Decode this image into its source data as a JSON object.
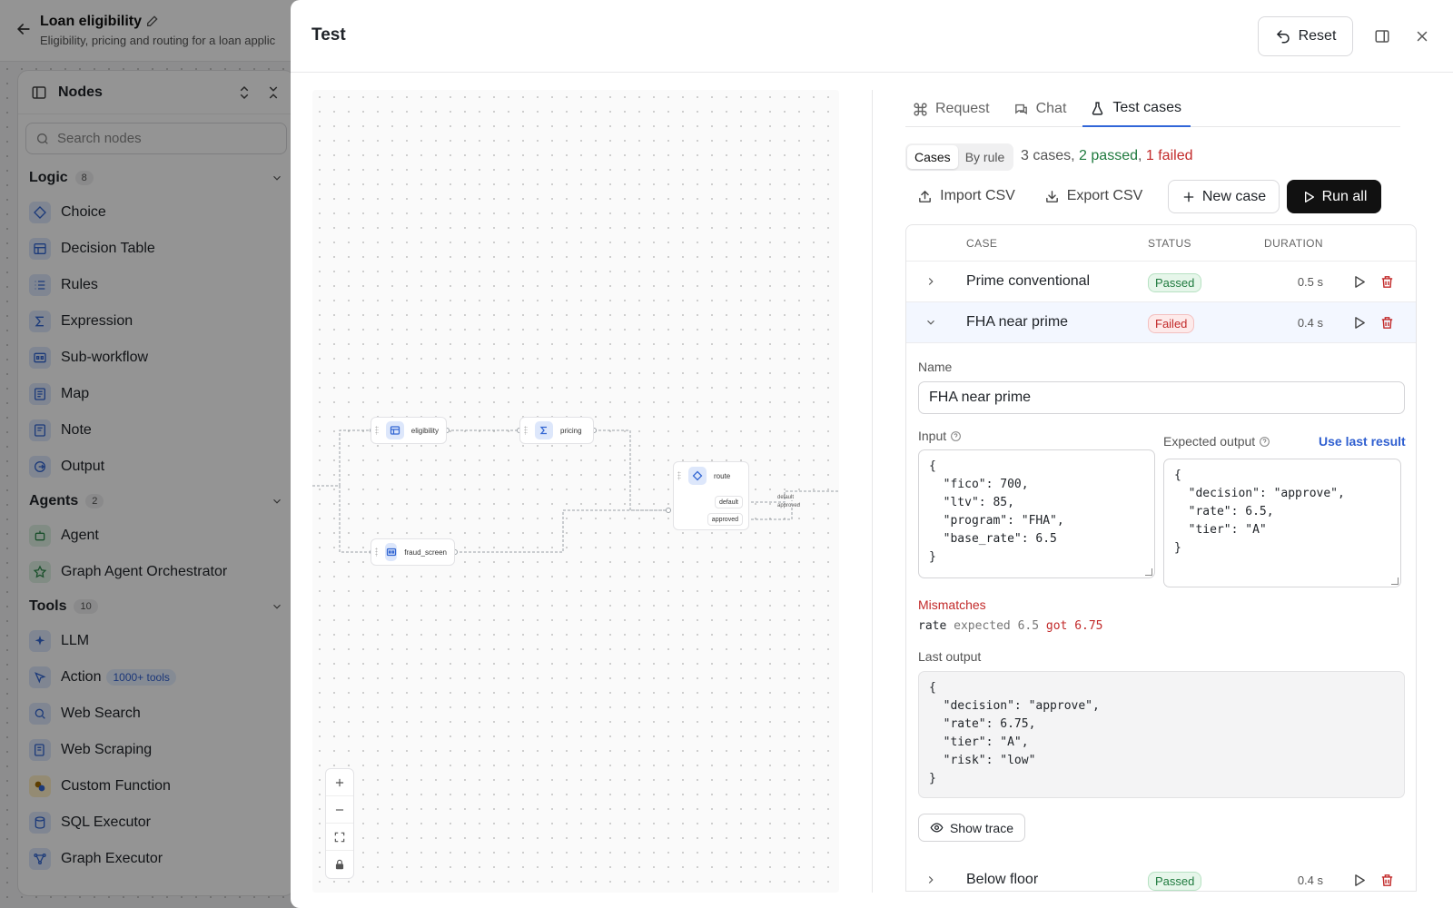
{
  "app": {
    "title": "Loan eligibility",
    "subtitle": "Eligibility, pricing and routing for a loan applic"
  },
  "nodes_panel": {
    "title": "Nodes",
    "search_placeholder": "Search nodes",
    "groups": [
      {
        "name": "Logic",
        "count": "8",
        "items": [
          {
            "label": "Choice",
            "icon": "choice-icon"
          },
          {
            "label": "Decision Table",
            "icon": "table-icon"
          },
          {
            "label": "Rules",
            "icon": "rules-icon"
          },
          {
            "label": "Expression",
            "icon": "sigma-icon"
          },
          {
            "label": "Sub-workflow",
            "icon": "subworkflow-icon"
          },
          {
            "label": "Map",
            "icon": "map-icon"
          },
          {
            "label": "Note",
            "icon": "note-icon"
          },
          {
            "label": "Output",
            "icon": "output-icon"
          }
        ]
      },
      {
        "name": "Agents",
        "count": "2",
        "items": [
          {
            "label": "Agent",
            "icon": "robot-icon"
          },
          {
            "label": "Graph Agent Orchestrator",
            "icon": "star-icon"
          }
        ]
      },
      {
        "name": "Tools",
        "count": "10",
        "items": [
          {
            "label": "LLM",
            "icon": "sparkle-icon"
          },
          {
            "label": "Action",
            "icon": "action-icon",
            "badge": "1000+ tools"
          },
          {
            "label": "Web Search",
            "icon": "search-icon"
          },
          {
            "label": "Web Scraping",
            "icon": "scrape-icon"
          },
          {
            "label": "Custom Function",
            "icon": "python-icon"
          },
          {
            "label": "SQL Executor",
            "icon": "database-icon"
          },
          {
            "label": "Graph Executor",
            "icon": "graph-icon"
          }
        ]
      }
    ]
  },
  "dialog": {
    "title": "Test",
    "reset_label": "Reset"
  },
  "canvas": {
    "nodes": {
      "eligibility": "eligibility",
      "pricing": "pricing",
      "fraud_screen": "fraud_screen",
      "route": "route"
    },
    "route_ports": {
      "default": "default",
      "approved": "approved"
    },
    "edge_labels": {
      "default": "default",
      "approved": "approved"
    }
  },
  "tabs": [
    {
      "label": "Request",
      "icon": "command-icon"
    },
    {
      "label": "Chat",
      "icon": "chat-icon"
    },
    {
      "label": "Test cases",
      "icon": "flask-icon",
      "active": true
    }
  ],
  "view_toggle": {
    "cases": "Cases",
    "by_rule": "By rule"
  },
  "summary": {
    "total": "3 cases,",
    "passed": "2 passed",
    "sep": ",",
    "failed": "1 failed"
  },
  "actions": {
    "import_csv": "Import CSV",
    "export_csv": "Export CSV",
    "new_case": "New case",
    "run_all": "Run all"
  },
  "table": {
    "headers": {
      "case": "CASE",
      "status": "STATUS",
      "duration": "DURATION"
    },
    "rows": [
      {
        "name": "Prime conventional",
        "status": "Passed",
        "duration": "0.5 s"
      },
      {
        "name": "FHA near prime",
        "status": "Failed",
        "duration": "0.4 s",
        "expanded": true
      },
      {
        "name": "Below floor",
        "status": "Passed",
        "duration": "0.4 s"
      }
    ]
  },
  "detail": {
    "name_label": "Name",
    "name_value": "FHA near prime",
    "input_label": "Input",
    "input_value": "{\n  \"fico\": 700,\n  \"ltv\": 85,\n  \"program\": \"FHA\",\n  \"base_rate\": 6.5\n}",
    "expected_label": "Expected output",
    "use_last_result": "Use last result",
    "expected_value": "{\n  \"decision\": \"approve\",\n  \"rate\": 6.5,\n  \"tier\": \"A\"\n}",
    "mismatches_label": "Mismatches",
    "mismatch": {
      "key": "rate",
      "expected": "expected 6.5",
      "got": "got 6.75"
    },
    "last_output_label": "Last output",
    "last_output_value": "{\n  \"decision\": \"approve\",\n  \"rate\": 6.75,\n  \"tier\": \"A\",\n  \"risk\": \"low\"\n}",
    "show_trace": "Show trace"
  },
  "colors": {
    "accent": "#3166d8",
    "passed": "#1f7a3e",
    "failed": "#c22a2a",
    "primary_button": "#111111"
  }
}
